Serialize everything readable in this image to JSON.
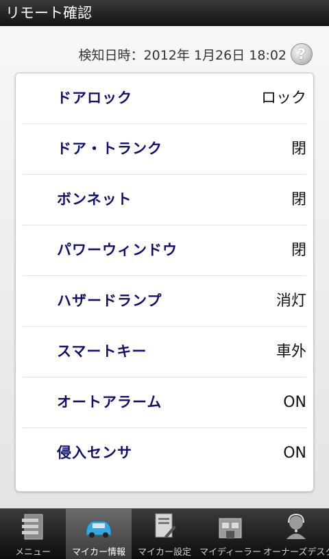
{
  "title": "リモート確認",
  "detection": {
    "label": "検知日時：2012年 1月26日 18:02",
    "help_icon": "question-icon"
  },
  "status_rows": [
    {
      "label": "ドアロック",
      "value": "ロック"
    },
    {
      "label": "ドア・トランク",
      "value": "閉"
    },
    {
      "label": "ボンネット",
      "value": "閉"
    },
    {
      "label": "パワーウィンドウ",
      "value": "閉"
    },
    {
      "label": "ハザードランプ",
      "value": "消灯"
    },
    {
      "label": "スマートキー",
      "value": "車外"
    },
    {
      "label": "オートアラーム",
      "value": "ON"
    },
    {
      "label": "侵入センサ",
      "value": "ON"
    }
  ],
  "tabs": [
    {
      "label": "メニュー",
      "icon": "menu-list-icon",
      "active": false
    },
    {
      "label": "マイカー情報",
      "icon": "car-icon",
      "active": true
    },
    {
      "label": "マイカー設定",
      "icon": "settings-document-icon",
      "active": false
    },
    {
      "label": "マイディーラー",
      "icon": "dealer-building-icon",
      "active": false
    },
    {
      "label": "オーナーズデスク",
      "icon": "headset-operator-icon",
      "active": false
    }
  ],
  "colors": {
    "row_label": "#10106a",
    "titlebar": "#1e1e1e",
    "active_tab": "#555555"
  }
}
